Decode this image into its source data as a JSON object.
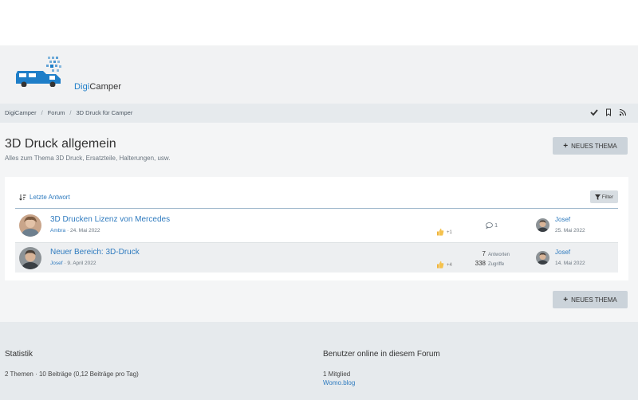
{
  "logo": {
    "part1": "Digi",
    "part2": "Camper"
  },
  "breadcrumb": [
    "DigiCamper",
    "Forum",
    "3D Druck für Camper"
  ],
  "page": {
    "title": "3D Druck allgemein",
    "description": "Alles zum Thema 3D Druck, Ersatzteile, Halterungen, usw."
  },
  "buttons": {
    "new_thread": "NEUES THEMA",
    "filter": "Filter"
  },
  "sort_label": "Letzte Antwort",
  "threads": [
    {
      "title": "3D Drucken Lizenz von Mercedes",
      "author": "Ambra",
      "date": "24. Mai 2022",
      "reactions": "+1",
      "replies": "1",
      "last_user": "Josef",
      "last_date": "25. Mai 2022"
    },
    {
      "title": "Neuer Bereich: 3D-Druck",
      "author": "Josef",
      "date": "9. April 2022",
      "reactions": "+4",
      "replies": "7",
      "replies_label": "Antworten",
      "views": "338",
      "views_label": "Zugriffe",
      "last_user": "Josef",
      "last_date": "14. Mai 2022"
    }
  ],
  "footer": {
    "stats_title": "Statistik",
    "stats_text": "2 Themen · 10 Beiträge (0,12 Beiträge pro Tag)",
    "online_title": "Benutzer online in diesem Forum",
    "online_count": "1 Mitglied",
    "online_user": "Womo.blog"
  },
  "colors": {
    "accent": "#2f7bbf",
    "button_bg": "#cbd3da"
  }
}
